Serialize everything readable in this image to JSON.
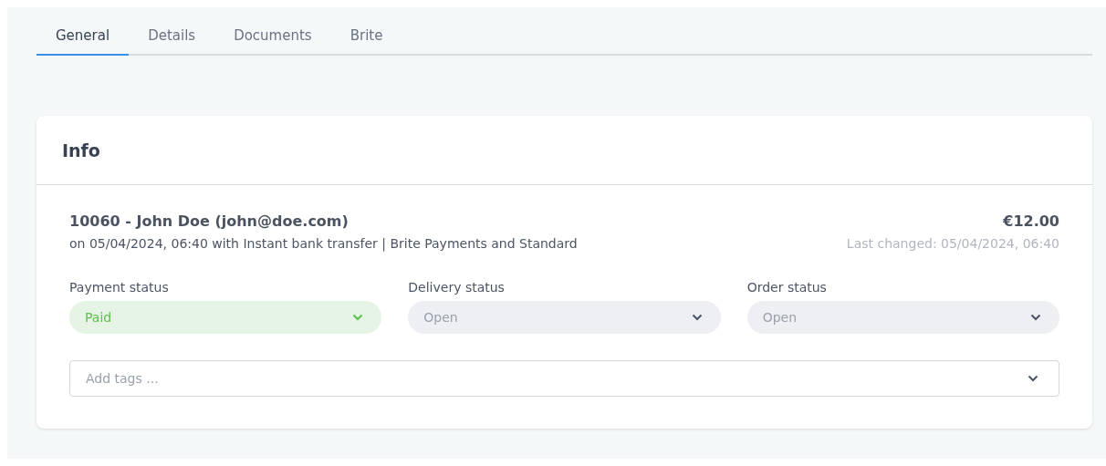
{
  "tabs": [
    {
      "label": "General",
      "selected": true
    },
    {
      "label": "Details",
      "selected": false
    },
    {
      "label": "Documents",
      "selected": false
    },
    {
      "label": "Brite",
      "selected": false
    }
  ],
  "info": {
    "title": "Info",
    "order_title": "10060 - John Doe (john@doe.com)",
    "order_subtitle": "on 05/04/2024, 06:40 with Instant bank transfer | Brite Payments and Standard",
    "amount": "€12.00",
    "last_changed": "Last changed: 05/04/2024, 06:40",
    "statuses": [
      {
        "label": "Payment status",
        "value": "Paid",
        "kind": "success"
      },
      {
        "label": "Delivery status",
        "value": "Open",
        "kind": "neutral"
      },
      {
        "label": "Order status",
        "value": "Open",
        "kind": "neutral"
      }
    ],
    "tags": {
      "placeholder": "Add tags ..."
    }
  }
}
